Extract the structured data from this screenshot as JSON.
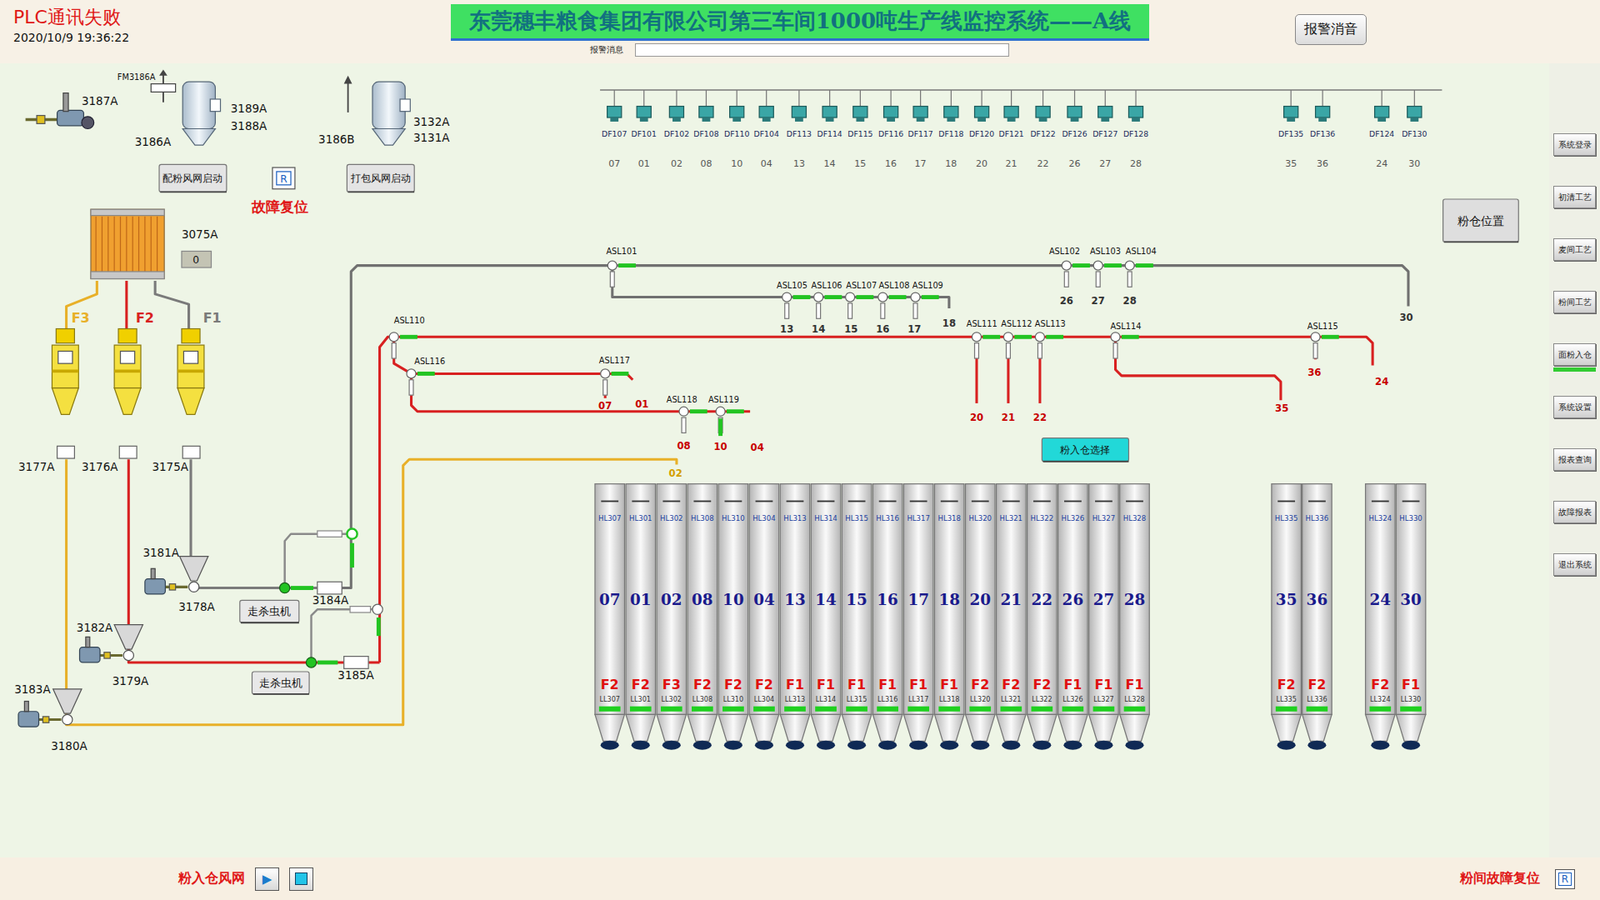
{
  "header": {
    "status": "PLC通讯失败",
    "datetime": "2020/10/9 19:36:22",
    "title": "东莞穗丰粮食集团有限公司第三车间1000吨生产线监控系统——A线",
    "mute_button": "报警消音"
  },
  "alarm_bar": {
    "label": "报警消息",
    "value": ""
  },
  "sidebar": {
    "items": [
      {
        "label": "系统登录",
        "selected": false
      },
      {
        "label": "初清工艺",
        "selected": false
      },
      {
        "label": "麦间工艺",
        "selected": false
      },
      {
        "label": "粉间工艺",
        "selected": false
      },
      {
        "label": "面粉入仓",
        "selected": true
      },
      {
        "label": "系统设置",
        "selected": false
      },
      {
        "label": "报表查询",
        "selected": false
      },
      {
        "label": "故障报表",
        "selected": false
      },
      {
        "label": "退出系统",
        "selected": false
      }
    ]
  },
  "footer": {
    "fan_label": "粉入仓风网",
    "start_icon": "▶",
    "fault_reset_label": "粉间故障复位",
    "reset_icon": "R"
  },
  "diagram": {
    "equipment_tags": [
      "FM3186A",
      "3187A",
      "3186A",
      "3189A",
      "3188A",
      "3186B",
      "3132A",
      "3131A",
      "3075A",
      "3177A",
      "3176A",
      "3175A",
      "3181A",
      "3178A",
      "3182A",
      "3179A",
      "3183A",
      "3180A",
      "3184A",
      "3185A"
    ],
    "buttons": [
      "配粉风网启动",
      "打包风网启动",
      "走杀虫机",
      "走杀虫机",
      "粉入仓选择",
      "粉仓位置"
    ],
    "fault_reset": {
      "label": "故障复位",
      "icon": "R"
    },
    "counter": "0",
    "feed_bins": [
      {
        "label": "F3",
        "color": "#e8b028"
      },
      {
        "label": "F2",
        "color": "#d82020"
      },
      {
        "label": "F1",
        "color": "#7a7a7a"
      }
    ],
    "dust_filters": [
      {
        "tag": "DF107",
        "number": "07"
      },
      {
        "tag": "DF101",
        "number": "01"
      },
      {
        "tag": "DF102",
        "number": "02"
      },
      {
        "tag": "DF108",
        "number": "08"
      },
      {
        "tag": "DF110",
        "number": "10"
      },
      {
        "tag": "DF104",
        "number": "04"
      },
      {
        "tag": "DF113",
        "number": "13"
      },
      {
        "tag": "DF114",
        "number": "14"
      },
      {
        "tag": "DF115",
        "number": "15"
      },
      {
        "tag": "DF116",
        "number": "16"
      },
      {
        "tag": "DF117",
        "number": "17"
      },
      {
        "tag": "DF118",
        "number": "18"
      },
      {
        "tag": "DF120",
        "number": "20"
      },
      {
        "tag": "DF121",
        "number": "21"
      },
      {
        "tag": "DF122",
        "number": "22"
      },
      {
        "tag": "DF126",
        "number": "26"
      },
      {
        "tag": "DF127",
        "number": "27"
      },
      {
        "tag": "DF128",
        "number": "28"
      },
      {
        "tag": "DF135",
        "number": "35"
      },
      {
        "tag": "DF136",
        "number": "36"
      },
      {
        "tag": "DF124",
        "number": "24"
      },
      {
        "tag": "DF130",
        "number": "30"
      }
    ],
    "valves": [
      {
        "tag": "ASL101"
      },
      {
        "tag": "ASL102"
      },
      {
        "tag": "ASL103"
      },
      {
        "tag": "ASL104"
      },
      {
        "tag": "ASL105"
      },
      {
        "tag": "ASL106"
      },
      {
        "tag": "ASL107"
      },
      {
        "tag": "ASL108"
      },
      {
        "tag": "ASL109"
      },
      {
        "tag": "ASL110"
      },
      {
        "tag": "ASL111"
      },
      {
        "tag": "ASL112"
      },
      {
        "tag": "ASL113"
      },
      {
        "tag": "ASL114"
      },
      {
        "tag": "ASL115"
      },
      {
        "tag": "ASL116"
      },
      {
        "tag": "ASL117"
      },
      {
        "tag": "ASL118"
      },
      {
        "tag": "ASL119"
      }
    ],
    "outlets": [
      {
        "label": "13",
        "color": "#333333"
      },
      {
        "label": "14",
        "color": "#333333"
      },
      {
        "label": "15",
        "color": "#333333"
      },
      {
        "label": "16",
        "color": "#333333"
      },
      {
        "label": "17",
        "color": "#333333"
      },
      {
        "label": "18",
        "color": "#333333"
      },
      {
        "label": "26",
        "color": "#333333"
      },
      {
        "label": "27",
        "color": "#333333"
      },
      {
        "label": "28",
        "color": "#333333"
      },
      {
        "label": "30",
        "color": "#333333"
      },
      {
        "label": "20",
        "color": "#c80000"
      },
      {
        "label": "21",
        "color": "#c80000"
      },
      {
        "label": "22",
        "color": "#c80000"
      },
      {
        "label": "35",
        "color": "#c80000"
      },
      {
        "label": "36",
        "color": "#c80000"
      },
      {
        "label": "24",
        "color": "#c80000"
      },
      {
        "label": "07",
        "color": "#c80000"
      },
      {
        "label": "01",
        "color": "#c80000"
      },
      {
        "label": "08",
        "color": "#c80000"
      },
      {
        "label": "10",
        "color": "#c80000"
      },
      {
        "label": "04",
        "color": "#c80000"
      },
      {
        "label": "02",
        "color": "#d4a000"
      }
    ],
    "silos": [
      {
        "number": "07",
        "high": "HL307",
        "flour": "F2",
        "low": "LL307"
      },
      {
        "number": "01",
        "high": "HL301",
        "flour": "F2",
        "low": "LL301"
      },
      {
        "number": "02",
        "high": "HL302",
        "flour": "F3",
        "low": "LL302"
      },
      {
        "number": "08",
        "high": "HL308",
        "flour": "F2",
        "low": "LL308"
      },
      {
        "number": "10",
        "high": "HL310",
        "flour": "F2",
        "low": "LL310"
      },
      {
        "number": "04",
        "high": "HL304",
        "flour": "F2",
        "low": "LL304"
      },
      {
        "number": "13",
        "high": "HL313",
        "flour": "F1",
        "low": "LL313"
      },
      {
        "number": "14",
        "high": "HL314",
        "flour": "F1",
        "low": "LL314"
      },
      {
        "number": "15",
        "high": "HL315",
        "flour": "F1",
        "low": "LL315"
      },
      {
        "number": "16",
        "high": "HL316",
        "flour": "F1",
        "low": "LL316"
      },
      {
        "number": "17",
        "high": "HL317",
        "flour": "F1",
        "low": "LL317"
      },
      {
        "number": "18",
        "high": "HL318",
        "flour": "F1",
        "low": "LL318"
      },
      {
        "number": "20",
        "high": "HL320",
        "flour": "F2",
        "low": "LL320"
      },
      {
        "number": "21",
        "high": "HL321",
        "flour": "F2",
        "low": "LL321"
      },
      {
        "number": "22",
        "high": "HL322",
        "flour": "F2",
        "low": "LL322"
      },
      {
        "number": "26",
        "high": "HL326",
        "flour": "F1",
        "low": "LL326"
      },
      {
        "number": "27",
        "high": "HL327",
        "flour": "F1",
        "low": "LL327"
      },
      {
        "number": "28",
        "high": "HL328",
        "flour": "F1",
        "low": "LL328"
      },
      {
        "number": "35",
        "high": "HL335",
        "flour": "F2",
        "low": "LL335"
      },
      {
        "number": "36",
        "high": "HL336",
        "flour": "F2",
        "low": "LL336"
      },
      {
        "number": "24",
        "high": "HL324",
        "flour": "F2",
        "low": "LL324"
      },
      {
        "number": "30",
        "high": "HL330",
        "flour": "F1",
        "low": "LL330"
      }
    ]
  }
}
